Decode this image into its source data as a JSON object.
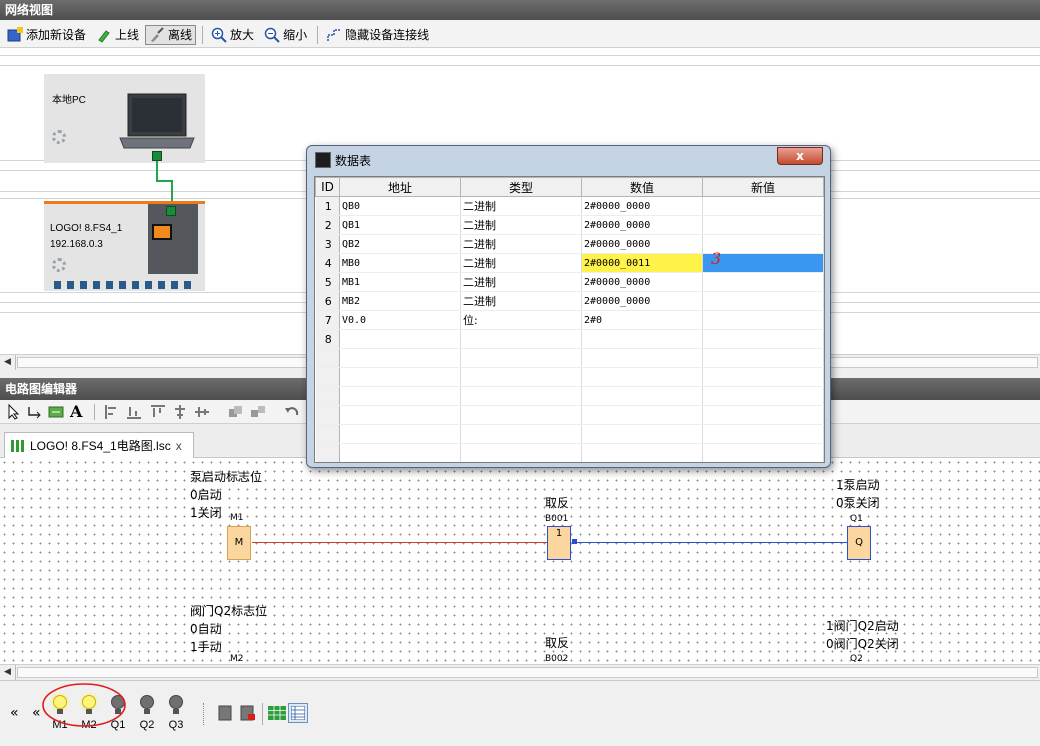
{
  "network": {
    "title": "网络视图",
    "toolbar": {
      "add_device": "添加新设备",
      "online": "上线",
      "offline": "离线",
      "zoom_in": "放大",
      "zoom_out": "缩小",
      "hide_links": "隐藏设备连接线"
    },
    "pc_label": "本地PC",
    "logo_name": "LOGO! 8.FS4_1",
    "logo_ip": "192.168.0.3"
  },
  "editor": {
    "title": "电路图编辑器",
    "tab_label": "LOGO! 8.FS4_1电路图.lsc",
    "tab_close": "x",
    "blocks": {
      "m1_comment": [
        "泵启动标志位",
        "0启动",
        "1关闭"
      ],
      "m1_name": "M1",
      "m1_letter": "M",
      "b001_title": "取反",
      "b001_name": "B001",
      "b001_sym": "1",
      "q1_comment": [
        "1泵启动",
        "0泵关闭"
      ],
      "q1_name": "Q1",
      "q1_letter": "Q",
      "m2_comment": [
        "阀门Q2标志位",
        "0自动",
        "1手动"
      ],
      "m2_name": "M2",
      "b002_title": "取反",
      "b002_name": "B002",
      "q2_comment": [
        "1阀门Q2启动",
        "0阀门Q2关闭"
      ],
      "q2_name": "Q2"
    }
  },
  "sim": {
    "nav_back": "«",
    "nav_back2": "«",
    "bulbs": [
      {
        "label": "M1",
        "on": true
      },
      {
        "label": "M2",
        "on": true
      },
      {
        "label": "Q1",
        "on": false
      },
      {
        "label": "Q2",
        "on": false
      },
      {
        "label": "Q3",
        "on": false
      }
    ]
  },
  "dialog": {
    "title": "数据表",
    "close": "x",
    "annotation": "3",
    "columns": [
      "ID",
      "地址",
      "类型",
      "数值",
      "新值"
    ],
    "rows": [
      {
        "id": "1",
        "address": "QB0",
        "type": "二进制",
        "value": "2#0000_0000",
        "new": ""
      },
      {
        "id": "2",
        "address": "QB1",
        "type": "二进制",
        "value": "2#0000_0000",
        "new": ""
      },
      {
        "id": "3",
        "address": "QB2",
        "type": "二进制",
        "value": "2#0000_0000",
        "new": ""
      },
      {
        "id": "4",
        "address": "MB0",
        "type": "二进制",
        "value": "2#0000_0011",
        "new": ""
      },
      {
        "id": "5",
        "address": "MB1",
        "type": "二进制",
        "value": "2#0000_0000",
        "new": ""
      },
      {
        "id": "6",
        "address": "MB2",
        "type": "二进制",
        "value": "2#0000_0000",
        "new": ""
      },
      {
        "id": "7",
        "address": "V0.0",
        "type": "位:",
        "value": "2#0",
        "new": ""
      },
      {
        "id": "8",
        "address": "",
        "type": "",
        "value": "",
        "new": ""
      }
    ]
  }
}
